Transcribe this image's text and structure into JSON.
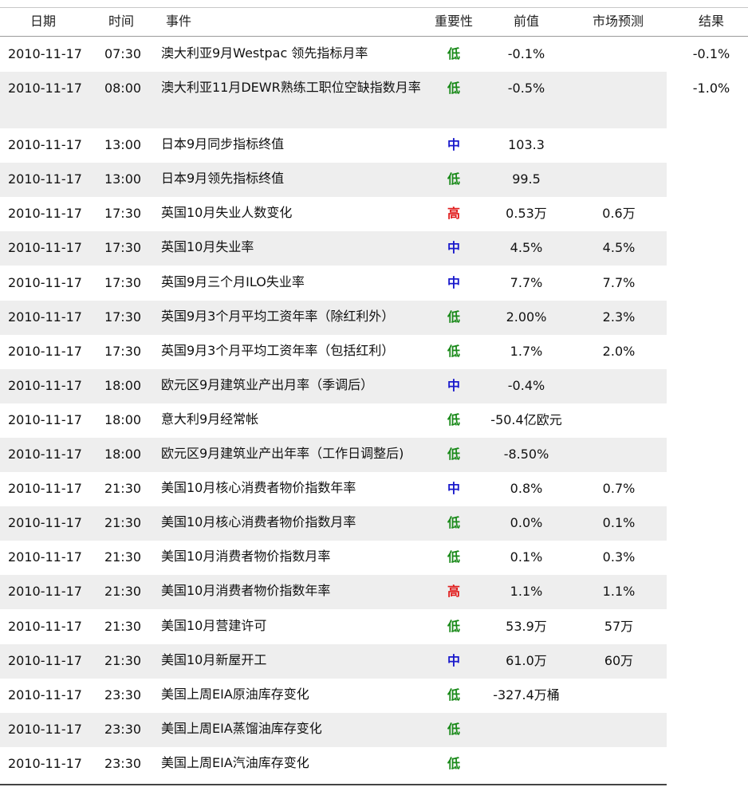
{
  "header": {
    "date": "日期",
    "time": "时间",
    "event": "事件",
    "importance": "重要性",
    "previous": "前值",
    "forecast": "市场预测",
    "result": "结果"
  },
  "colors": {
    "low": "#1a8a1a",
    "medium": "#1a1acc",
    "high": "#e01a1a",
    "row_alt": "#eeeeee"
  },
  "rows": [
    {
      "date": "2010-11-17",
      "time": "07:30",
      "event": "澳大利亚9月Westpac 领先指标月率",
      "importance": "低",
      "level": "low",
      "previous": "-0.1%",
      "forecast": "",
      "result": "-0.1%"
    },
    {
      "date": "2010-11-17",
      "time": "08:00",
      "event": "澳大利亚11月DEWR熟练工职位空缺指数月率",
      "importance": "低",
      "level": "low",
      "previous": "-0.5%",
      "forecast": "",
      "result": "-1.0%"
    },
    {
      "date": "2010-11-17",
      "time": "13:00",
      "event": "日本9月同步指标终值",
      "importance": "中",
      "level": "medium",
      "previous": "103.3",
      "forecast": "",
      "result": ""
    },
    {
      "date": "2010-11-17",
      "time": "13:00",
      "event": "日本9月领先指标终值",
      "importance": "低",
      "level": "low",
      "previous": "99.5",
      "forecast": "",
      "result": ""
    },
    {
      "date": "2010-11-17",
      "time": "17:30",
      "event": "英国10月失业人数变化",
      "importance": "高",
      "level": "high",
      "previous": "0.53万",
      "forecast": "0.6万",
      "result": ""
    },
    {
      "date": "2010-11-17",
      "time": "17:30",
      "event": "英国10月失业率",
      "importance": "中",
      "level": "medium",
      "previous": "4.5%",
      "forecast": "4.5%",
      "result": ""
    },
    {
      "date": "2010-11-17",
      "time": "17:30",
      "event": "英国9月三个月ILO失业率",
      "importance": "中",
      "level": "medium",
      "previous": "7.7%",
      "forecast": "7.7%",
      "result": ""
    },
    {
      "date": "2010-11-17",
      "time": "17:30",
      "event": "英国9月3个月平均工资年率（除红利外）",
      "importance": "低",
      "level": "low",
      "previous": "2.00%",
      "forecast": "2.3%",
      "result": ""
    },
    {
      "date": "2010-11-17",
      "time": "17:30",
      "event": "英国9月3个月平均工资年率（包括红利）",
      "importance": "低",
      "level": "low",
      "previous": "1.7%",
      "forecast": "2.0%",
      "result": ""
    },
    {
      "date": "2010-11-17",
      "time": "18:00",
      "event": "欧元区9月建筑业产出月率（季调后）",
      "importance": "中",
      "level": "medium",
      "previous": "-0.4%",
      "forecast": "",
      "result": ""
    },
    {
      "date": "2010-11-17",
      "time": "18:00",
      "event": "意大利9月经常帐",
      "importance": "低",
      "level": "low",
      "previous": "-50.4亿欧元",
      "forecast": "",
      "result": ""
    },
    {
      "date": "2010-11-17",
      "time": "18:00",
      "event": "欧元区9月建筑业产出年率（工作日调整后)",
      "importance": "低",
      "level": "low",
      "previous": "-8.50%",
      "forecast": "",
      "result": ""
    },
    {
      "date": "2010-11-17",
      "time": "21:30",
      "event": "美国10月核心消费者物价指数年率",
      "importance": "中",
      "level": "medium",
      "previous": "0.8%",
      "forecast": "0.7%",
      "result": ""
    },
    {
      "date": "2010-11-17",
      "time": "21:30",
      "event": "美国10月核心消费者物价指数月率",
      "importance": "低",
      "level": "low",
      "previous": "0.0%",
      "forecast": "0.1%",
      "result": ""
    },
    {
      "date": "2010-11-17",
      "time": "21:30",
      "event": "美国10月消费者物价指数月率",
      "importance": "低",
      "level": "low",
      "previous": "0.1%",
      "forecast": "0.3%",
      "result": ""
    },
    {
      "date": "2010-11-17",
      "time": "21:30",
      "event": "美国10月消费者物价指数年率",
      "importance": "高",
      "level": "high",
      "previous": "1.1%",
      "forecast": "1.1%",
      "result": ""
    },
    {
      "date": "2010-11-17",
      "time": "21:30",
      "event": "美国10月营建许可",
      "importance": "低",
      "level": "low",
      "previous": "53.9万",
      "forecast": "57万",
      "result": ""
    },
    {
      "date": "2010-11-17",
      "time": "21:30",
      "event": "美国10月新屋开工",
      "importance": "中",
      "level": "medium",
      "previous": "61.0万",
      "forecast": "60万",
      "result": ""
    },
    {
      "date": "2010-11-17",
      "time": "23:30",
      "event": "美国上周EIA原油库存变化",
      "importance": "低",
      "level": "low",
      "previous": "-327.4万桶",
      "forecast": "",
      "result": ""
    },
    {
      "date": "2010-11-17",
      "time": "23:30",
      "event": "美国上周EIA蒸馏油库存变化",
      "importance": "低",
      "level": "low",
      "previous": "",
      "forecast": "",
      "result": ""
    },
    {
      "date": "2010-11-17",
      "time": "23:30",
      "event": "美国上周EIA汽油库存变化",
      "importance": "低",
      "level": "low",
      "previous": "",
      "forecast": "",
      "result": ""
    }
  ]
}
